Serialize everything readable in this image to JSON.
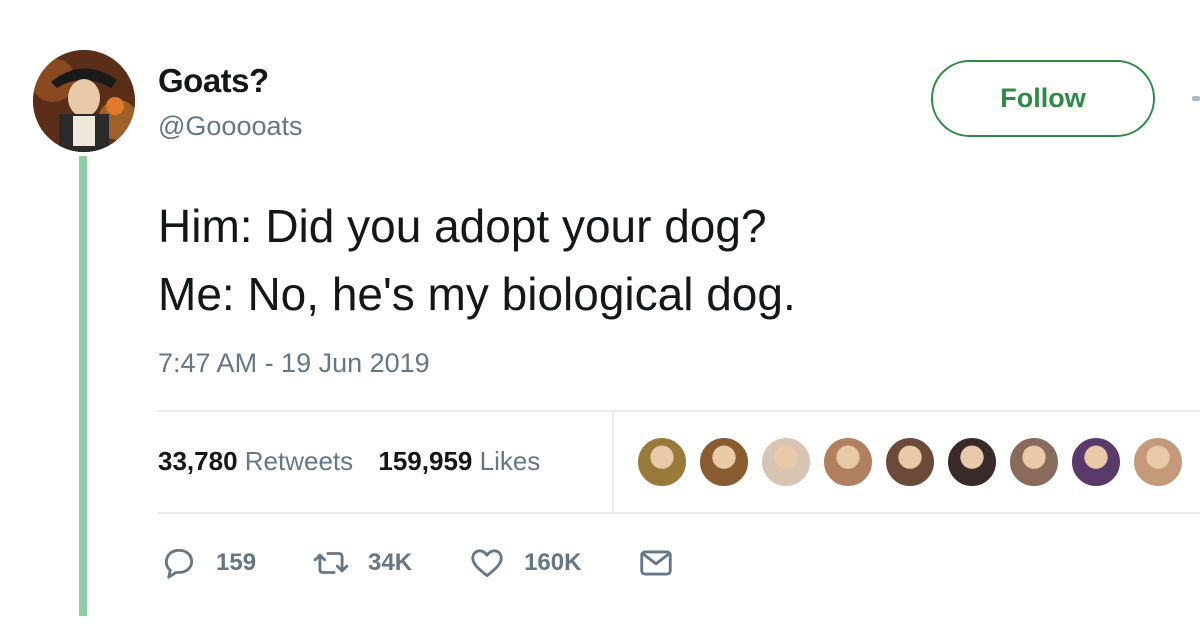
{
  "user": {
    "name": "Goats?",
    "handle": "@Gooooats",
    "avatar_icon": "portrait-avatar"
  },
  "follow_label": "Follow",
  "tweet": {
    "lines": [
      "Him: Did you adopt your dog?",
      "Me: No, he's my biological dog."
    ],
    "timestamp": "7:47 AM - 19 Jun 2019"
  },
  "stats": {
    "retweets_count": "33,780",
    "retweets_label": "Retweets",
    "likes_count": "159,959",
    "likes_label": "Likes"
  },
  "likers": [
    "#9a7a3a",
    "#8a5a30",
    "#d9c4b4",
    "#b08060",
    "#6c4a3a",
    "#3a2a2a",
    "#8a6a5a",
    "#5a3a6a",
    "#c49a7a"
  ],
  "actions": {
    "reply_count": "159",
    "retweet_count": "34K",
    "like_count": "160K"
  },
  "colors": {
    "accent": "#2f8a45",
    "thread_line": "#8ecfa6",
    "secondary_text": "#657786"
  }
}
